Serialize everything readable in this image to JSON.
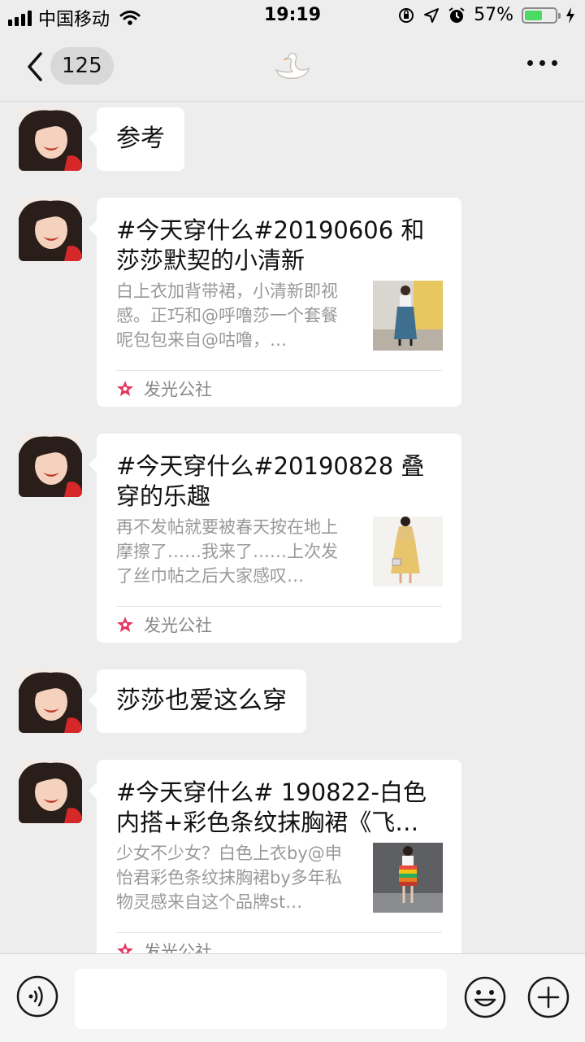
{
  "status_bar": {
    "carrier": "中国移动",
    "time": "19:19",
    "battery_percent": "57%",
    "battery_level": 0.57
  },
  "nav": {
    "unread_count": "125",
    "title_icon": "swan-icon"
  },
  "messages": [
    {
      "type": "text",
      "text": "参考"
    },
    {
      "type": "card",
      "title": "#今天穿什么#20190606 和莎莎默契的小清新",
      "description": "白上衣加背带裙，小清新即视感。正巧和@呼噜莎一个套餐呢包包来自@咕噜，…",
      "source": "发光公社"
    },
    {
      "type": "card",
      "title": "#今天穿什么#20190828 叠穿的乐趣",
      "description": "再不发帖就要被春天按在地上摩擦了……我来了……上次发了丝巾帖之后大家感叹…",
      "source": "发光公社"
    },
    {
      "type": "text",
      "text": "莎莎也爱这么穿"
    },
    {
      "type": "card",
      "title": "#今天穿什么# 190822-白色内搭+彩色条纹抹胸裙《飞…",
      "description": "少女不少女？白色上衣by@申怡君彩色条纹抹胸裙by多年私物灵感来自这个品牌st…",
      "source": "发光公社"
    }
  ],
  "colors": {
    "background": "#ededed",
    "bubble": "#ffffff",
    "source_star": "#e5355e",
    "battery": "#4cd964"
  }
}
